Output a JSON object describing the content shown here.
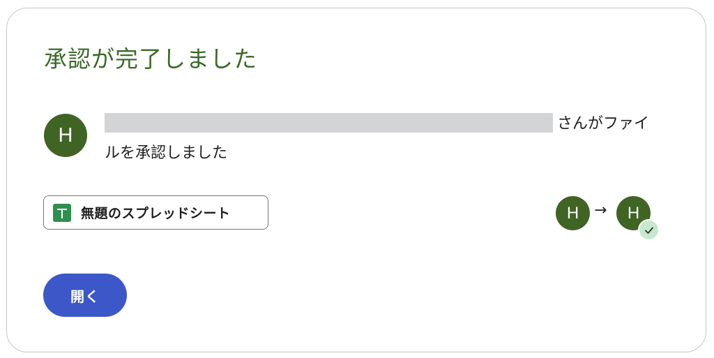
{
  "dialog": {
    "title": "承認が完了しました",
    "approver_avatar_letter": "H",
    "message_suffix": "さんがファイルを承認しました"
  },
  "file_chip": {
    "icon": "sheets-icon",
    "name": "無題のスプレッドシート"
  },
  "status_flow": {
    "from_avatar_letter": "H",
    "arrow": "→",
    "to_avatar_letter": "H",
    "badge_icon": "check-icon"
  },
  "actions": {
    "open_label": "開く"
  },
  "colors": {
    "title_green": "#3a6b27",
    "avatar_green": "#3f6424",
    "button_blue": "#3b57c8",
    "badge_green": "#c7e8cf"
  }
}
